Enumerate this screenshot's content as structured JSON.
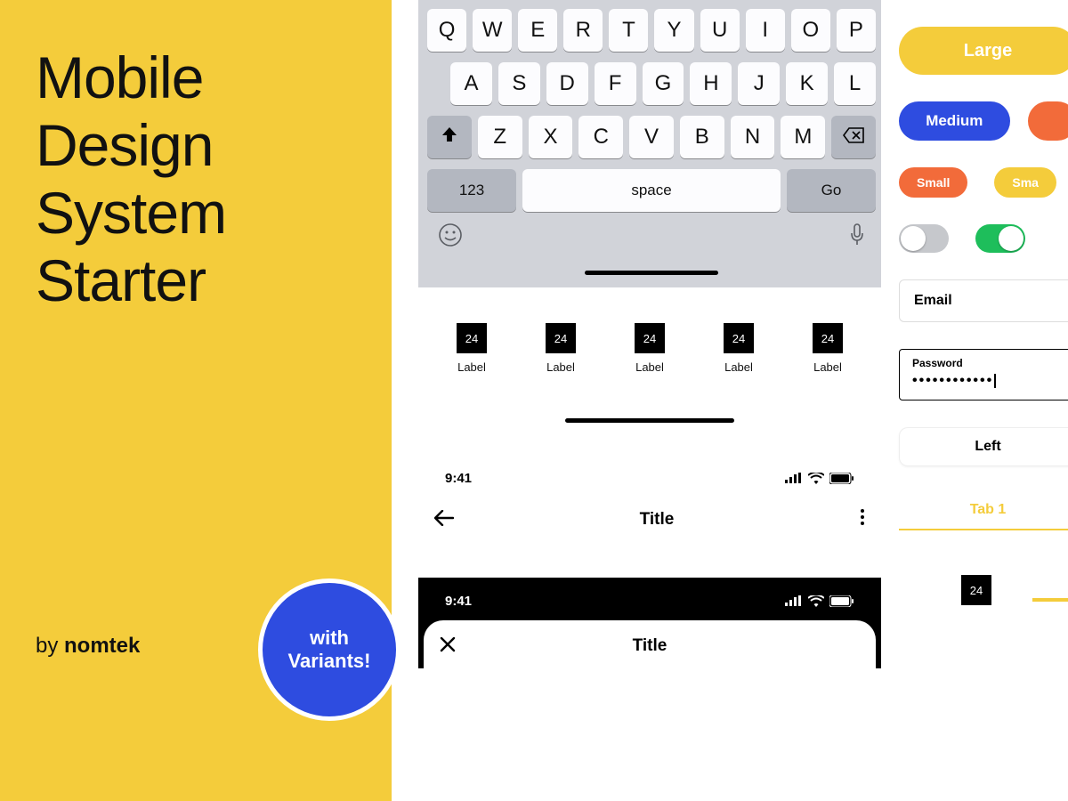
{
  "hero": {
    "title_lines": [
      "Mobile",
      "Design",
      "System",
      "Starter"
    ],
    "by_prefix": "by ",
    "brand": "nomtek",
    "badge_line1": "with",
    "badge_line2": "Variants!"
  },
  "keyboard": {
    "row1": [
      "Q",
      "W",
      "E",
      "R",
      "T",
      "Y",
      "U",
      "I",
      "O",
      "P"
    ],
    "row2": [
      "A",
      "S",
      "D",
      "F",
      "G",
      "H",
      "J",
      "K",
      "L"
    ],
    "row3": [
      "Z",
      "X",
      "C",
      "V",
      "B",
      "N",
      "M"
    ],
    "numKey": "123",
    "spaceKey": "space",
    "goKey": "Go"
  },
  "tabbar": {
    "icon_size": "24",
    "label": "Label"
  },
  "statusbar": {
    "time": "9:41"
  },
  "navbar": {
    "title": "Title"
  },
  "buttons": {
    "large": "Large",
    "medium": "Medium",
    "small": "Small",
    "small2": "Sma"
  },
  "fields": {
    "email_label": "Email",
    "password_label": "Password",
    "password_value": "••••••••••••"
  },
  "segmented": {
    "left": "Left"
  },
  "tabs": {
    "tab1": "Tab 1"
  },
  "mini": {
    "size": "24"
  }
}
